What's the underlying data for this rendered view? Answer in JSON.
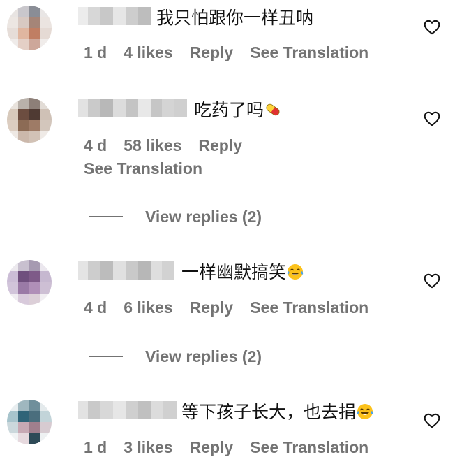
{
  "comments": [
    {
      "text": "我只怕跟你一样丑呐",
      "time": "1 d",
      "likes": "4 likes",
      "reply": "Reply",
      "translate": "See Translation"
    },
    {
      "text": "吃药了吗",
      "time": "4 d",
      "likes": "58 likes",
      "reply": "Reply",
      "translate": "See Translation",
      "view_replies": "View replies (2)"
    },
    {
      "text": "一样幽默搞笑",
      "time": "4 d",
      "likes": "6 likes",
      "reply": "Reply",
      "translate": "See Translation",
      "view_replies": "View replies (2)"
    },
    {
      "text": "等下孩子长大，也去捐",
      "time": "1 d",
      "likes": "3 likes",
      "reply": "Reply",
      "translate": "See Translation"
    }
  ],
  "icons": {
    "like": "heart-outline-icon",
    "pill": "pill-emoji",
    "laugh": "face-with-tears-of-joy-emoji"
  },
  "colors": {
    "text": "#111111",
    "meta": "#737373"
  }
}
